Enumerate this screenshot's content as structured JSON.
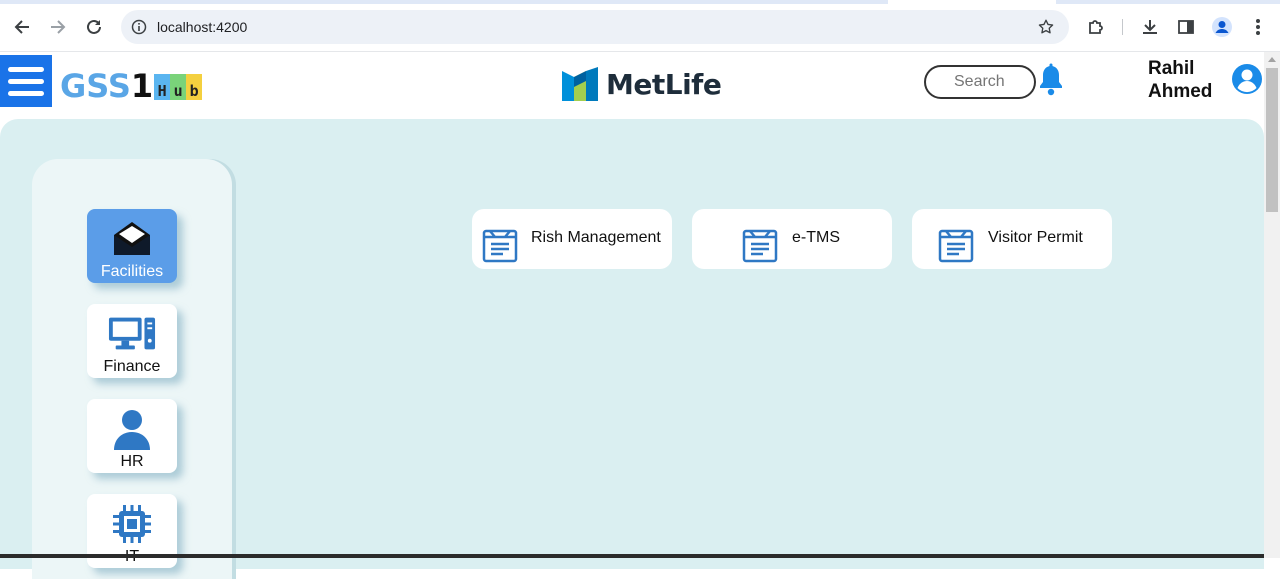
{
  "browser": {
    "url": "localhost:4200",
    "icons": [
      "back-icon",
      "forward-icon",
      "reload-icon",
      "info-icon",
      "star-icon",
      "extensions-icon",
      "download-icon",
      "side-panel-icon",
      "profile-icon",
      "menu-icon"
    ]
  },
  "header": {
    "logo": {
      "gss": "GSS",
      "one": "1",
      "hub": [
        "H",
        "u",
        "b"
      ]
    },
    "brand": "MetLife",
    "search_placeholder": "Search",
    "user": {
      "first": "Rahil",
      "last": "Ahmed"
    }
  },
  "sidebar": {
    "items": [
      {
        "label": "Facilities",
        "icon": "envelope-open-icon",
        "active": true
      },
      {
        "label": "Finance",
        "icon": "computer-icon",
        "active": false
      },
      {
        "label": "HR",
        "icon": "person-icon",
        "active": false
      },
      {
        "label": "IT",
        "icon": "chip-icon",
        "active": false
      }
    ]
  },
  "cards": [
    {
      "label": "Rish Management",
      "icon": "document-icon"
    },
    {
      "label": "e-TMS",
      "icon": "document-icon"
    },
    {
      "label": "Visitor Permit",
      "icon": "document-icon"
    }
  ],
  "colors": {
    "accent": "#1a73e8",
    "main_bg": "#daeff1",
    "active_tile": "#5b9de8",
    "icon_blue": "#2f78c4"
  }
}
